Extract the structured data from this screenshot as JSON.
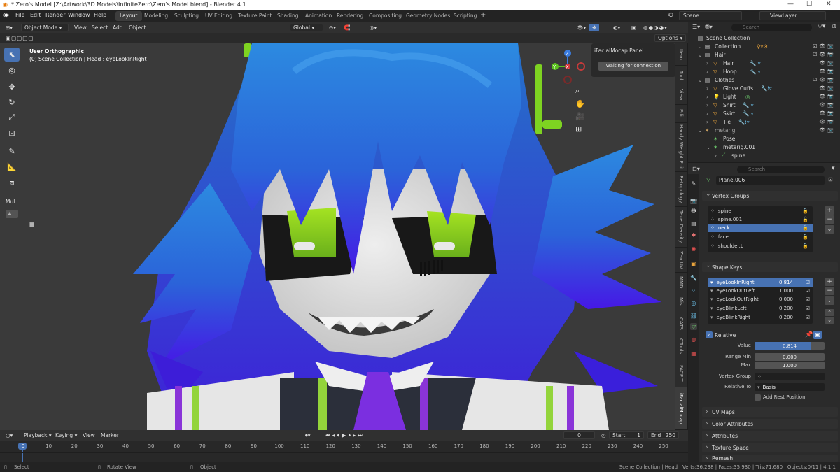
{
  "window": {
    "title": "* Zero's Model [Z:\\Artwork\\3D Models\\InfiniteZero\\Zero's Model.blend] - Blender 4.1",
    "controls": [
      "—",
      "☐",
      "✕"
    ]
  },
  "menus": [
    "File",
    "Edit",
    "Render",
    "Window",
    "Help"
  ],
  "workspaces": [
    "Layout",
    "Modeling",
    "Sculpting",
    "UV Editing",
    "Texture Paint",
    "Shading",
    "Animation",
    "Rendering",
    "Compositing",
    "Geometry Nodes",
    "Scripting"
  ],
  "active_workspace": "Layout",
  "scene": {
    "scene_name": "Scene",
    "view_layer": "ViewLayer"
  },
  "viewport_header": {
    "mode": "Object Mode",
    "menus": [
      "View",
      "Select",
      "Add",
      "Object"
    ],
    "orientation": "Global",
    "options_label": "Options"
  },
  "viewport": {
    "view_name": "User Orthographic",
    "context": "(0) Scene Collection | Head : eyeLookInRight",
    "side_label": "Mul",
    "side_button": "A..."
  },
  "npanel": {
    "title": "iFacialMocap Panel",
    "button": "waiting for connection"
  },
  "side_tabs": [
    "Item",
    "Tool",
    "View",
    "Edit",
    "Handy Weight Edit",
    "Retopology",
    "Texel Density",
    "Zen UV",
    "MMD",
    "Misc",
    "CATS",
    "CTools",
    "FACEIT",
    "iFacialMocap"
  ],
  "gizmo": {
    "x": "X",
    "y": "Y",
    "z": "Z"
  },
  "outliner": {
    "search_placeholder": "Search",
    "items": [
      {
        "label": "Scene Collection"
      },
      {
        "label": "Collection"
      },
      {
        "label": "Hair"
      },
      {
        "label": "Hair"
      },
      {
        "label": "Hoop"
      },
      {
        "label": "Clothes"
      },
      {
        "label": "Glove Cuffs"
      },
      {
        "label": "Light"
      },
      {
        "label": "Shirt"
      },
      {
        "label": "Skirt"
      },
      {
        "label": "Tie"
      },
      {
        "label": "metarig"
      },
      {
        "label": "Pose"
      },
      {
        "label": "metarig.001"
      },
      {
        "label": "spine"
      }
    ]
  },
  "properties": {
    "search_placeholder": "Search",
    "object_name": "Plane.006",
    "vertex_groups_title": "Vertex Groups",
    "vertex_groups": [
      "spine",
      "spine.001",
      "neck",
      "face",
      "shoulder.L"
    ],
    "selected_vertex_group": "neck",
    "shape_keys_title": "Shape Keys",
    "shape_keys": [
      {
        "name": "eyeLookInRight",
        "value": "0.814"
      },
      {
        "name": "eyeLookOutLeft",
        "value": "1.000"
      },
      {
        "name": "eyeLookOutRight",
        "value": "0.000"
      },
      {
        "name": "eyeBlinkLeft",
        "value": "0.200"
      },
      {
        "name": "eyeBlinkRight",
        "value": "0.200"
      }
    ],
    "relative_label": "Relative",
    "value_label": "Value",
    "value": "0.814",
    "value_fraction": 0.814,
    "range_min_label": "Range Min",
    "range_min": "0.000",
    "max_label": "Max",
    "max": "1.000",
    "vertex_group_label": "Vertex Group",
    "relative_to_label": "Relative To",
    "relative_to": "Basis",
    "add_rest_label": "Add Rest Position",
    "sections": [
      "UV Maps",
      "Color Attributes",
      "Attributes",
      "Texture Space",
      "Remesh"
    ]
  },
  "timeline": {
    "menus": [
      "Playback",
      "Keying",
      "View",
      "Marker"
    ],
    "current_frame": "0",
    "start_label": "Start",
    "start": "1",
    "end_label": "End",
    "end": "250",
    "ticks": [
      "0",
      "10",
      "20",
      "30",
      "40",
      "50",
      "60",
      "70",
      "80",
      "90",
      "100",
      "110",
      "120",
      "130",
      "140",
      "150",
      "160",
      "170",
      "180",
      "190",
      "200",
      "210",
      "220",
      "230",
      "240",
      "250"
    ]
  },
  "status": {
    "select": "Select",
    "rotate": "Rotate View",
    "object": "Object",
    "stats": "Scene Collection | Head | Verts:36,238 | Faces:35,930 | Tris:71,680 | Objects:0/11 | 4.1.1"
  },
  "colors": {
    "accent": "#4772b3",
    "hair_light": "#2f7fd8",
    "hair_dark": "#4b1ee0",
    "eye_green": "#9be21f",
    "tie_purple": "#7b2fe0"
  }
}
